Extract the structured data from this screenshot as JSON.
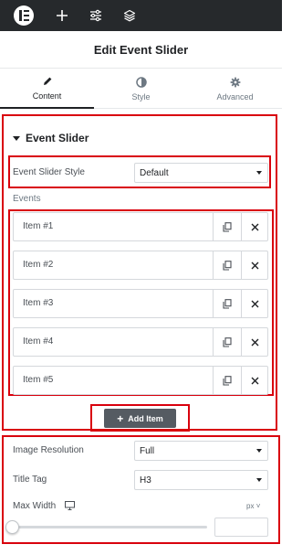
{
  "toolbar": {
    "icons": [
      "elementor-logo-icon",
      "plus-icon",
      "sliders-icon",
      "layers-icon"
    ]
  },
  "header": {
    "title": "Edit Event Slider"
  },
  "tabs": [
    {
      "label": "Content",
      "icon": "pencil-icon",
      "active": true
    },
    {
      "label": "Style",
      "icon": "half-circle-icon",
      "active": false
    },
    {
      "label": "Advanced",
      "icon": "gear-icon",
      "active": false
    }
  ],
  "section": {
    "title": "Event Slider"
  },
  "style_control": {
    "label": "Event Slider Style",
    "value": "Default"
  },
  "events": {
    "label": "Events",
    "items": [
      {
        "title": "Item #1"
      },
      {
        "title": "Item #2"
      },
      {
        "title": "Item #3"
      },
      {
        "title": "Item #4"
      },
      {
        "title": "Item #5"
      }
    ],
    "add_label": "Add Item"
  },
  "image_resolution": {
    "label": "Image Resolution",
    "value": "Full"
  },
  "title_tag": {
    "label": "Title Tag",
    "value": "H3"
  },
  "max_width": {
    "label": "Max Width",
    "unit": "px",
    "value": "",
    "slider_level": 0
  },
  "colors": {
    "highlight": "#d9000d",
    "topbar": "#26292c",
    "add_button": "#555b62"
  }
}
